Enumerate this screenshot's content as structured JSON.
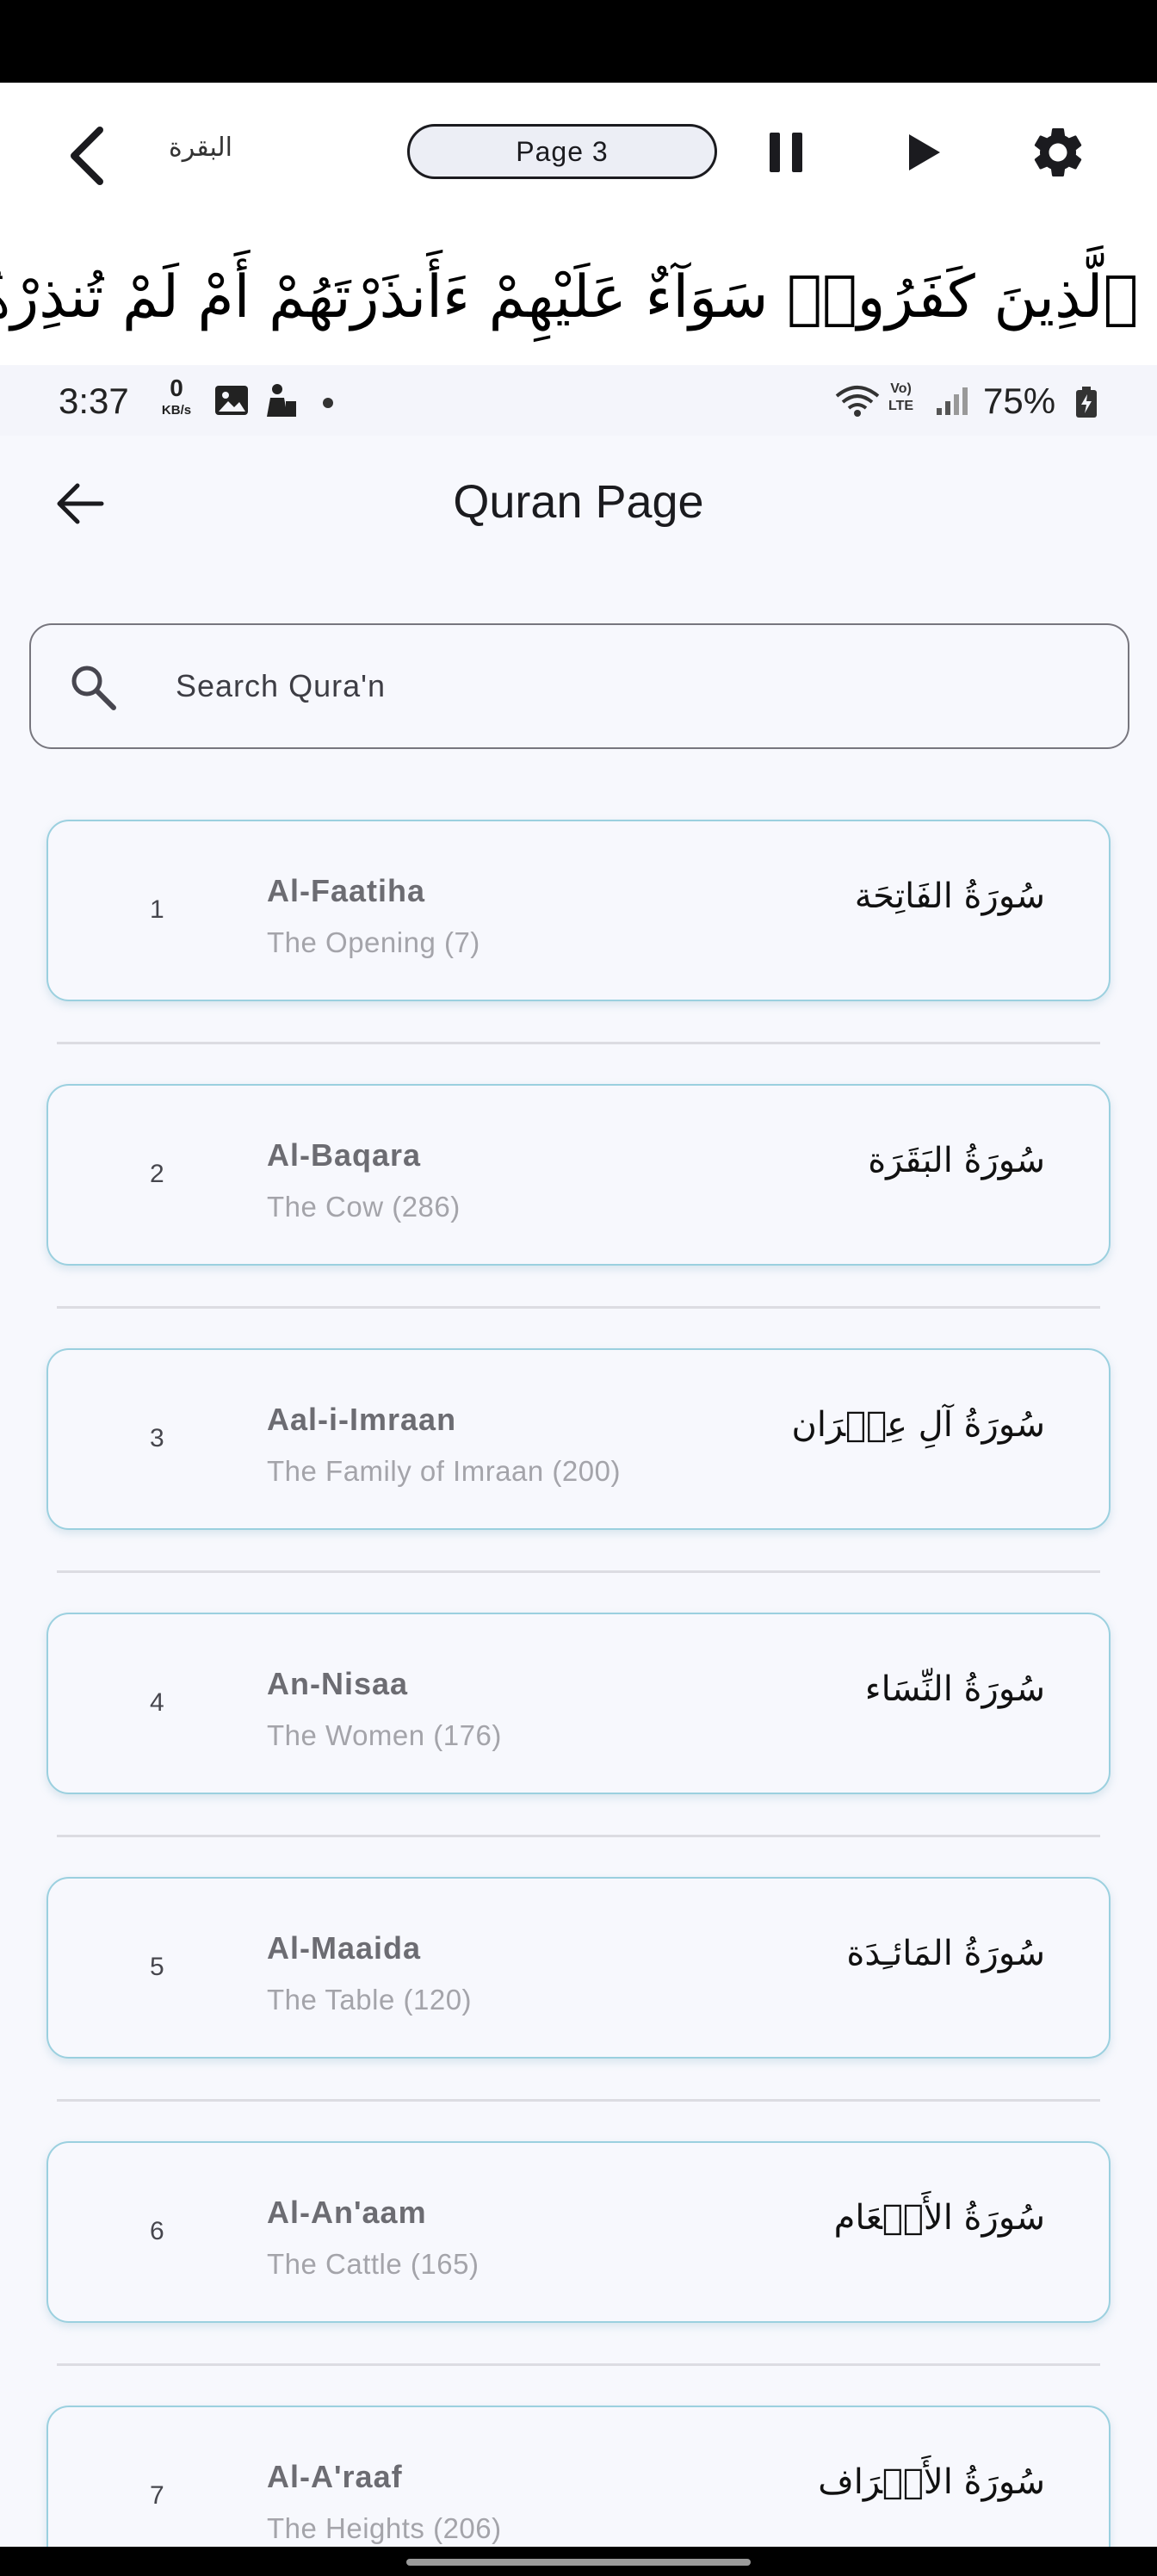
{
  "player": {
    "surah_label": "البقرة",
    "page_label": "Page  3",
    "ayah_text": "إِنَّ ٱلَّذِينَ كَفَرُوا۟ سَوَآءٌ عَلَيْهِمْ ءَأَنذَرْتَهُمْ أَمْ لَمْ تُنذِرْهُمْ"
  },
  "status_bar": {
    "time": "3:37",
    "net_speed": "0",
    "net_unit": "KB/s",
    "lte_top": "Vo)",
    "lte_bottom": "LTE",
    "battery": "75%"
  },
  "app_bar": {
    "title": "Quran Page"
  },
  "search": {
    "placeholder": "Search Qura'n",
    "value": ""
  },
  "surahs": [
    {
      "number": "1",
      "name": "Al-Faatiha",
      "meaning": "The Opening (7)",
      "arabic": "سُورَةُ الفَاتِحَة"
    },
    {
      "number": "2",
      "name": "Al-Baqara",
      "meaning": "The Cow (286)",
      "arabic": "سُورَةُ البَقَرَة"
    },
    {
      "number": "3",
      "name": "Aal-i-Imraan",
      "meaning": "The Family of Imraan (200)",
      "arabic": "سُورَةُ آلِ عِمۡرَان"
    },
    {
      "number": "4",
      "name": "An-Nisaa",
      "meaning": "The Women (176)",
      "arabic": "سُورَةُ النِّسَاء"
    },
    {
      "number": "5",
      "name": "Al-Maaida",
      "meaning": "The Table (120)",
      "arabic": "سُورَةُ المَائـِدَة"
    },
    {
      "number": "6",
      "name": "Al-An'aam",
      "meaning": "The Cattle (165)",
      "arabic": "سُورَةُ الأَنۡعَام"
    },
    {
      "number": "7",
      "name": "Al-A'raaf",
      "meaning": "The Heights (206)",
      "arabic": "سُورَةُ الأَعۡرَاف"
    }
  ],
  "icons": {
    "back": "chevron-left-icon",
    "pause": "pause-icon",
    "play": "play-icon",
    "settings": "gear-icon",
    "search": "search-icon"
  }
}
